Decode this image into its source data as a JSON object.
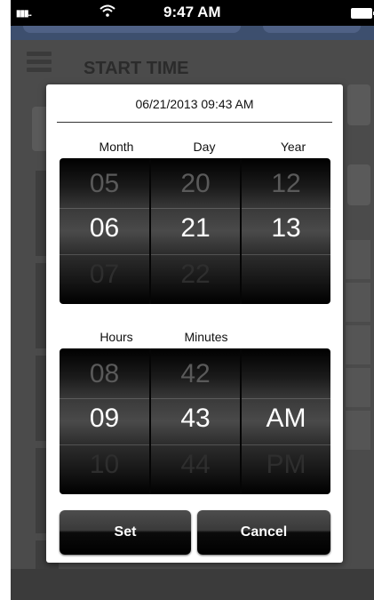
{
  "status_bar": {
    "signal": "▮▮▮..",
    "wifi_icon": "wifi-icon",
    "time": "9:47 AM",
    "battery_icon": "battery-icon"
  },
  "background": {
    "menu_icon": "hamburger-menu-icon",
    "title": "START TIME"
  },
  "dialog": {
    "header": "06/21/2013 09:43 AM",
    "date_picker": {
      "labels": {
        "month": "Month",
        "day": "Day",
        "year": "Year"
      },
      "month": {
        "prev": "05",
        "cur": "06",
        "next": "07"
      },
      "day": {
        "prev": "20",
        "cur": "21",
        "next": "22"
      },
      "year": {
        "prev": "12",
        "cur": "13",
        "next": ""
      }
    },
    "time_picker": {
      "labels": {
        "hours": "Hours",
        "minutes": "Minutes"
      },
      "hours": {
        "prev": "08",
        "cur": "09",
        "next": "10"
      },
      "minutes": {
        "prev": "42",
        "cur": "43",
        "next": "44"
      },
      "ampm": {
        "prev": "",
        "cur": "AM",
        "next": "PM"
      }
    },
    "buttons": {
      "set": "Set",
      "cancel": "Cancel"
    }
  }
}
